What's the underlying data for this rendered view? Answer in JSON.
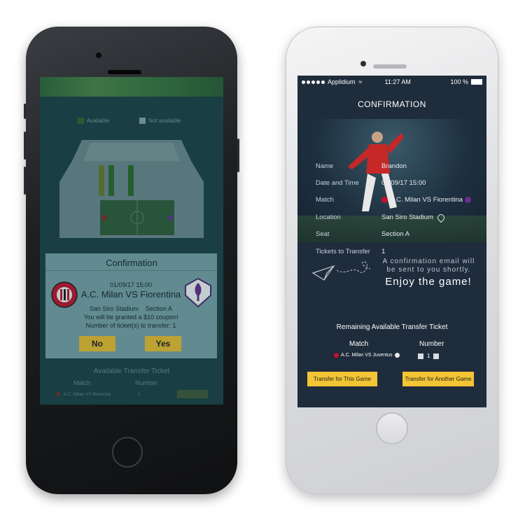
{
  "left_phone": {
    "legend": {
      "available": "Available",
      "not_available": "Not available"
    },
    "colors": {
      "available": "#2e7a2c",
      "not_available": "#c8cfd2",
      "button": "#f4c531",
      "modal": "#7ba7ad"
    },
    "modal": {
      "title": "Confirmation",
      "datetime": "01/09/17 15:00",
      "match": "A.C. Milan VS Fiorentina",
      "stadium": "San Siro Stadium",
      "section": "Section A",
      "coupon_prefix": "You will be granted a",
      "coupon_amount": "$10 coupon!",
      "tickets_label": "Number of ticket(s) to transfer:",
      "tickets_value": "1",
      "no_label": "No",
      "yes_label": "Yes"
    },
    "background": {
      "available_title": "Available Transfer Ticket",
      "col_match": "Match",
      "col_number": "Number",
      "row_match": "A.C. Milan VS Borussia",
      "row_number": "1"
    }
  },
  "right_phone": {
    "status": {
      "carrier": "Applidium",
      "time": "11:27 AM",
      "battery": "100 %"
    },
    "title": "CONFIRMATION",
    "details": [
      {
        "label": "Name",
        "value": "Brandon"
      },
      {
        "label": "Date and Time",
        "value": "01/09/17 15:00"
      },
      {
        "label": "Match",
        "value": "A.C. Milan VS Fiorentina"
      },
      {
        "label": "Location",
        "value": "San Siro Stadium"
      },
      {
        "label": "Seat",
        "value": "Section A"
      },
      {
        "label": "Tickets to Transfer",
        "value": "1"
      }
    ],
    "email_message": "A confirmation email will be sent to you shortly.",
    "enjoy": "Enjoy the game!",
    "remaining_title": "Remaining Available Transfer Ticket",
    "col_match": "Match",
    "col_number": "Number",
    "row_match": "A.C. Milan VS Juventus",
    "row_number": "1",
    "btn_this_game": "Transfer for This Game",
    "btn_another_game": "Transfer for Another Game",
    "colors": {
      "screen": "#1f2c3c",
      "button": "#f3c434"
    }
  }
}
